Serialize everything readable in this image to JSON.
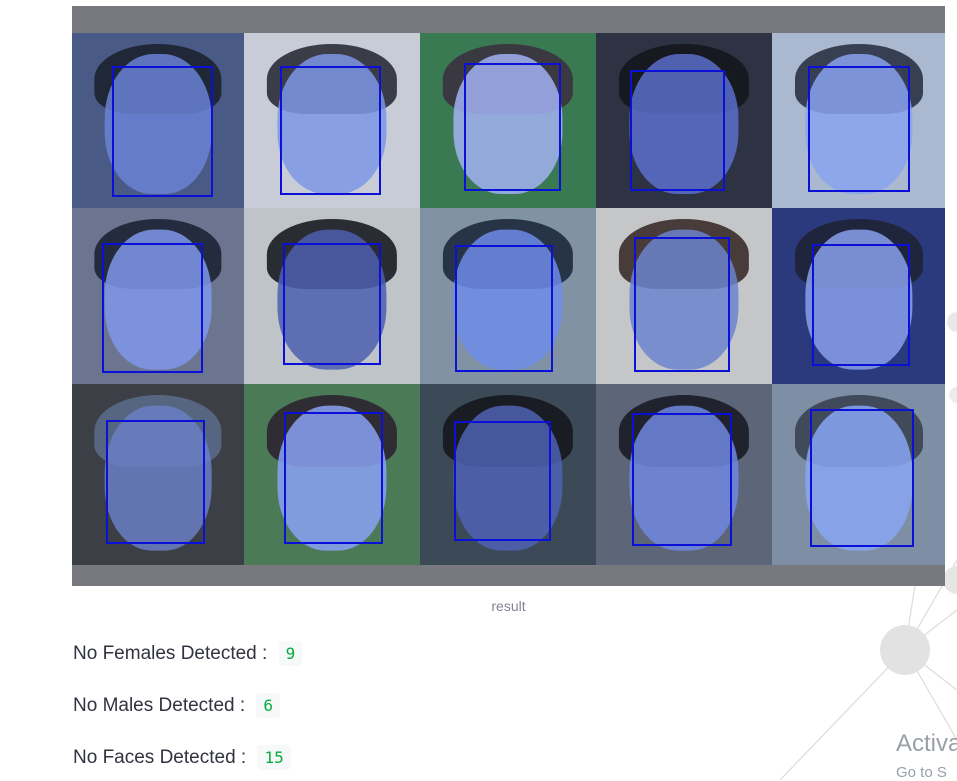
{
  "image": {
    "caption": "result",
    "faces": [
      {
        "bg": "#4a5a86",
        "skin": "#6a82d6",
        "hair": "#1c2230"
      },
      {
        "bg": "#c7ccd6",
        "skin": "#7e96e6",
        "hair": "#2a2c38"
      },
      {
        "bg": "#3a7a52",
        "skin": "#a2b2f2",
        "hair": "#3b3240"
      },
      {
        "bg": "#2e3344",
        "skin": "#5c6ecc",
        "hair": "#14161c"
      },
      {
        "bg": "#aab9cf",
        "skin": "#8aa2ee",
        "hair": "#2a3344"
      },
      {
        "bg": "#6b7590",
        "skin": "#7f98ea",
        "hair": "#1e2436"
      },
      {
        "bg": "#bec4c8",
        "skin": "#4d5fae",
        "hair": "#1a1c22"
      },
      {
        "bg": "#8092a4",
        "skin": "#6e8ce8",
        "hair": "#1d2a3e"
      },
      {
        "bg": "#c4c6c8",
        "skin": "#6c84cc",
        "hair": "#3a2c2a"
      },
      {
        "bg": "#2b3a7c",
        "skin": "#8aa0ec",
        "hair": "#1e2436"
      },
      {
        "bg": "#3c4046",
        "skin": "#6a7fc4",
        "hair": "#5a6a86"
      },
      {
        "bg": "#4a7a56",
        "skin": "#8aa2f4",
        "hair": "#2c2430"
      },
      {
        "bg": "#3c4a58",
        "skin": "#4f62b4",
        "hair": "#15171d"
      },
      {
        "bg": "#5c6678",
        "skin": "#7088e0",
        "hair": "#1a1c26"
      },
      {
        "bg": "#7e8ea4",
        "skin": "#8aa6f4",
        "hair": "#3a4252"
      }
    ]
  },
  "stats": {
    "females_label": "No Females Detected : ",
    "females_value": "9",
    "males_label": "No Males Detected : ",
    "males_value": "6",
    "faces_label": "No Faces Detected : ",
    "faces_value": "15"
  },
  "watermark": {
    "line1": "Activa",
    "line2": "Go to S"
  },
  "colors": {
    "bbox": "#0a10d8",
    "value_text": "#09ab3b",
    "value_bg": "#f7f8fa",
    "frame": "#77797e"
  }
}
